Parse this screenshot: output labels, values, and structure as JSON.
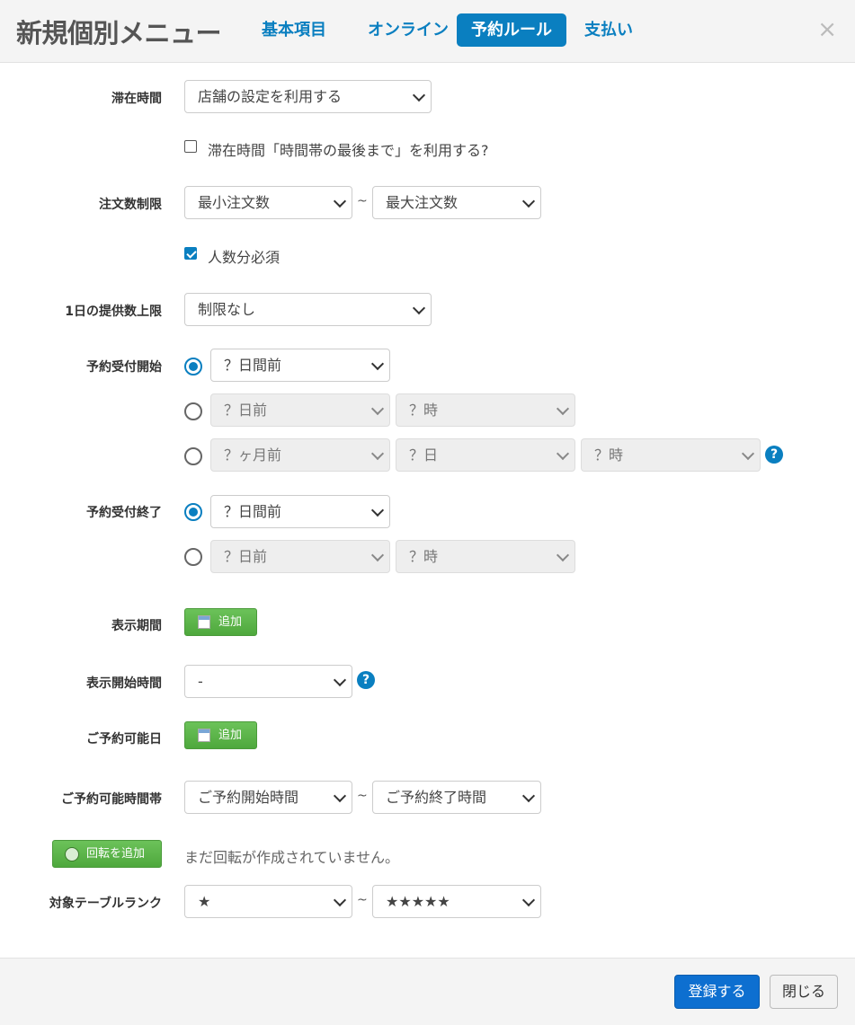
{
  "header": {
    "title": "新規個別メニュー",
    "tabs": [
      {
        "label": "基本項目",
        "active": false
      },
      {
        "label": "オンライン",
        "active": false
      },
      {
        "label": "予約ルール",
        "active": true
      },
      {
        "label": "支払い",
        "active": false
      }
    ],
    "close": "×"
  },
  "stay_time": {
    "label": "滞在時間",
    "value": "店舗の設定を利用する",
    "checkbox_label": "滞在時間「時間帯の最後まで」を利用する?",
    "checked": false
  },
  "order_limit": {
    "label": "注文数制限",
    "min_value": "最小注文数",
    "max_value": "最大注文数",
    "tilde": "~",
    "checkbox_label": "人数分必須",
    "checked": true
  },
  "daily_limit": {
    "label": "1日の提供数上限",
    "value": "制限なし"
  },
  "reservation_start": {
    "label": "予約受付開始",
    "opt1": "？日間前",
    "opt2": [
      "？日前",
      "？時"
    ],
    "opt3": [
      "？ヶ月前",
      "？日",
      "？時"
    ],
    "help": "?"
  },
  "reservation_end": {
    "label": "予約受付終了",
    "opt1": "？日間前",
    "opt2": [
      "？日前",
      "？時"
    ]
  },
  "display_period": {
    "label": "表示期間",
    "button": "追加"
  },
  "display_start_time": {
    "label": "表示開始時間",
    "value": "-",
    "help": "?"
  },
  "available_days": {
    "label": "ご予約可能日",
    "button": "追加"
  },
  "available_time": {
    "label": "ご予約可能時間帯",
    "start": "ご予約開始時間",
    "end": "ご予約終了時間",
    "tilde": "~"
  },
  "rotation": {
    "button": "回転を追加",
    "message": "まだ回転が作成されていません。"
  },
  "table_rank": {
    "label": "対象テーブルランク",
    "min": "★",
    "max": "★★★★★",
    "tilde": "~"
  },
  "footer": {
    "save": "登録する",
    "close": "閉じる"
  },
  "colors": {
    "accent": "#0a7fc0",
    "primary_button": "#0d6fd0",
    "green_button": "#5cb85c"
  }
}
